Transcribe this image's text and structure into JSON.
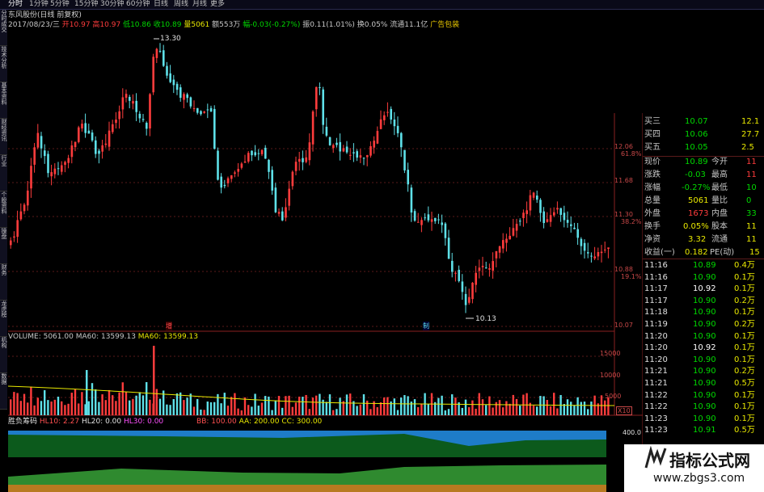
{
  "colors": {
    "up": "#ff3c3c",
    "down": "#5ee0e8",
    "green": "#00d800",
    "yellow": "#e8e800",
    "white": "#ffffff",
    "grid": "#5a1a1a"
  },
  "tabs": [
    "分时",
    "1分钟",
    "5分钟",
    "15分钟",
    "30分钟",
    "60分钟",
    "日线",
    "周线",
    "月线",
    "更多"
  ],
  "side_tabs": [
    "分时成交",
    "技术分析",
    "基本资料",
    "财经资讯",
    "行业",
    "个股资料",
    "操盘",
    "财务",
    "龙虎榜",
    "机构",
    "数据"
  ],
  "stock": {
    "title": "东风股份(日线 前复权)",
    "date": "2017/08/23/三",
    "open": "开10.97",
    "high": "高10.97",
    "low": "低10.86",
    "close": "收10.89",
    "volume": "量5061",
    "amount": "额553万",
    "change": "幅-0.03(-0.27%)",
    "amplitude": "振0.11(1.01%)",
    "turnover": "换0.05%",
    "float": "流通11.1亿",
    "tag": "广告包装"
  },
  "price_axis": [
    {
      "value": "12.06",
      "pct": "61.8%"
    },
    {
      "value": "11.68",
      "pct": ""
    },
    {
      "value": "11.30",
      "pct": "38.2%"
    },
    {
      "value": "10.88",
      "pct": "19.1%"
    },
    {
      "value": "10.07",
      "pct": ""
    }
  ],
  "annotations": {
    "high_label": "13.30",
    "low_label": "10.13",
    "marker_a": "增",
    "marker_b": "制"
  },
  "volume_info": {
    "title": "VOLUME:",
    "vol": "5061.00",
    "ma5": "MA60: 13599.13",
    "ma10": "MA60: 13599.13"
  },
  "volume_axis": [
    "15000",
    "10000",
    "5000",
    "X10"
  ],
  "indicator": {
    "title": "胜负筹码",
    "hl10": "HL10: 2.27",
    "hl20": "HL20: 0.00",
    "hl30": "HL30: 0.00",
    "bb": "BB: 100.00",
    "aa": "AA: 200.00",
    "cc": "CC: 300.00",
    "axis_value": "400.0"
  },
  "order_book": [
    {
      "label": "买三",
      "price": "10.07",
      "vol": "12.1"
    },
    {
      "label": "买四",
      "price": "10.06",
      "vol": "27.7"
    },
    {
      "label": "买五",
      "price": "10.05",
      "vol": "2.5"
    }
  ],
  "quote": [
    {
      "l1": "现价",
      "v1": "10.89",
      "l2": "今开",
      "v2": "11"
    },
    {
      "l1": "涨跌",
      "v1": "-0.03",
      "l2": "最高",
      "v2": "11"
    },
    {
      "l1": "涨幅",
      "v1": "-0.27%",
      "l2": "最低",
      "v2": "10"
    },
    {
      "l1": "总量",
      "v1": "5061",
      "l2": "量比",
      "v2": "0"
    },
    {
      "l1": "外盘",
      "v1": "1673",
      "l2": "内盘",
      "v2": "33"
    },
    {
      "l1": "换手",
      "v1": "0.05%",
      "l2": "股本",
      "v2": "11"
    },
    {
      "l1": "净资",
      "v1": "3.32",
      "l2": "流通",
      "v2": "11"
    },
    {
      "l1": "收益(一)",
      "v1": "0.182",
      "l2": "PE(动)",
      "v2": "15"
    }
  ],
  "ticks": [
    {
      "time": "11:16",
      "price": "10.89",
      "vol": "0.4万"
    },
    {
      "time": "11:16",
      "price": "10.90",
      "vol": "0.1万"
    },
    {
      "time": "11:17",
      "price": "10.92",
      "vol": "0.1万"
    },
    {
      "time": "11:17",
      "price": "10.90",
      "vol": "0.2万"
    },
    {
      "time": "11:18",
      "price": "10.90",
      "vol": "0.1万"
    },
    {
      "time": "11:19",
      "price": "10.90",
      "vol": "0.2万"
    },
    {
      "time": "11:20",
      "price": "10.90",
      "vol": "0.1万"
    },
    {
      "time": "11:20",
      "price": "10.92",
      "vol": "0.1万"
    },
    {
      "time": "11:20",
      "price": "10.90",
      "vol": "0.1万"
    },
    {
      "time": "11:21",
      "price": "10.90",
      "vol": "0.2万"
    },
    {
      "time": "11:21",
      "price": "10.90",
      "vol": "0.5万"
    },
    {
      "time": "11:22",
      "price": "10.90",
      "vol": "0.1万"
    },
    {
      "time": "11:22",
      "price": "10.90",
      "vol": "0.1万"
    },
    {
      "time": "11:23",
      "price": "10.90",
      "vol": "0.1万"
    },
    {
      "time": "11:23",
      "price": "10.91",
      "vol": "0.5万"
    }
  ],
  "watermark": {
    "title": "指标公式网",
    "url": "www.zbgs3.com"
  }
}
